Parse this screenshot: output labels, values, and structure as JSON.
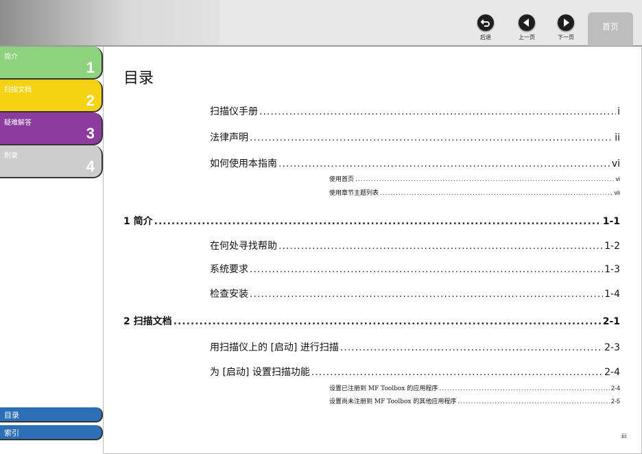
{
  "nav": {
    "back_label": "后退",
    "prev_label": "上一页",
    "next_label": "下一页",
    "home_label": "首页"
  },
  "sidebar": {
    "chapters": [
      {
        "label": "简介",
        "number": "1",
        "color": "#8fd27e"
      },
      {
        "label": "扫描文档",
        "number": "2",
        "color": "#f5d312"
      },
      {
        "label": "疑难解答",
        "number": "3",
        "color": "#8b3c9c"
      },
      {
        "label": "附录",
        "number": "4",
        "color": "#cdcdcd"
      }
    ],
    "links": [
      {
        "label": "目录"
      },
      {
        "label": "索引"
      }
    ]
  },
  "content": {
    "title": "目录",
    "entries": [
      {
        "text": "扫描仪手册",
        "page": "i"
      },
      {
        "text": "法律声明",
        "page": "ii"
      },
      {
        "text": "如何使用本指南",
        "page": "vi"
      },
      {
        "text": "使用首页",
        "page": "vi"
      },
      {
        "text": "使用章节主题列表",
        "page": "vii"
      },
      {
        "text": "1 简介",
        "page": "1-1"
      },
      {
        "text": "在何处寻找帮助",
        "page": "1-2"
      },
      {
        "text": "系统要求",
        "page": "1-3"
      },
      {
        "text": "检查安装",
        "page": "1-4"
      },
      {
        "text": "2 扫描文档",
        "page": "2-1"
      },
      {
        "text": "用扫描仪上的 [启动] 进行扫描",
        "page": "2-3"
      },
      {
        "text": "为 [启动] 设置扫描功能",
        "page": "2-4"
      },
      {
        "text": "设置已注册到 MF Toolbox 的应用程序",
        "page": "2-4"
      },
      {
        "text": "设置尚未注册到 MF Toolbox 的其他应用程序",
        "page": "2-5"
      }
    ],
    "page_number": "iii"
  }
}
